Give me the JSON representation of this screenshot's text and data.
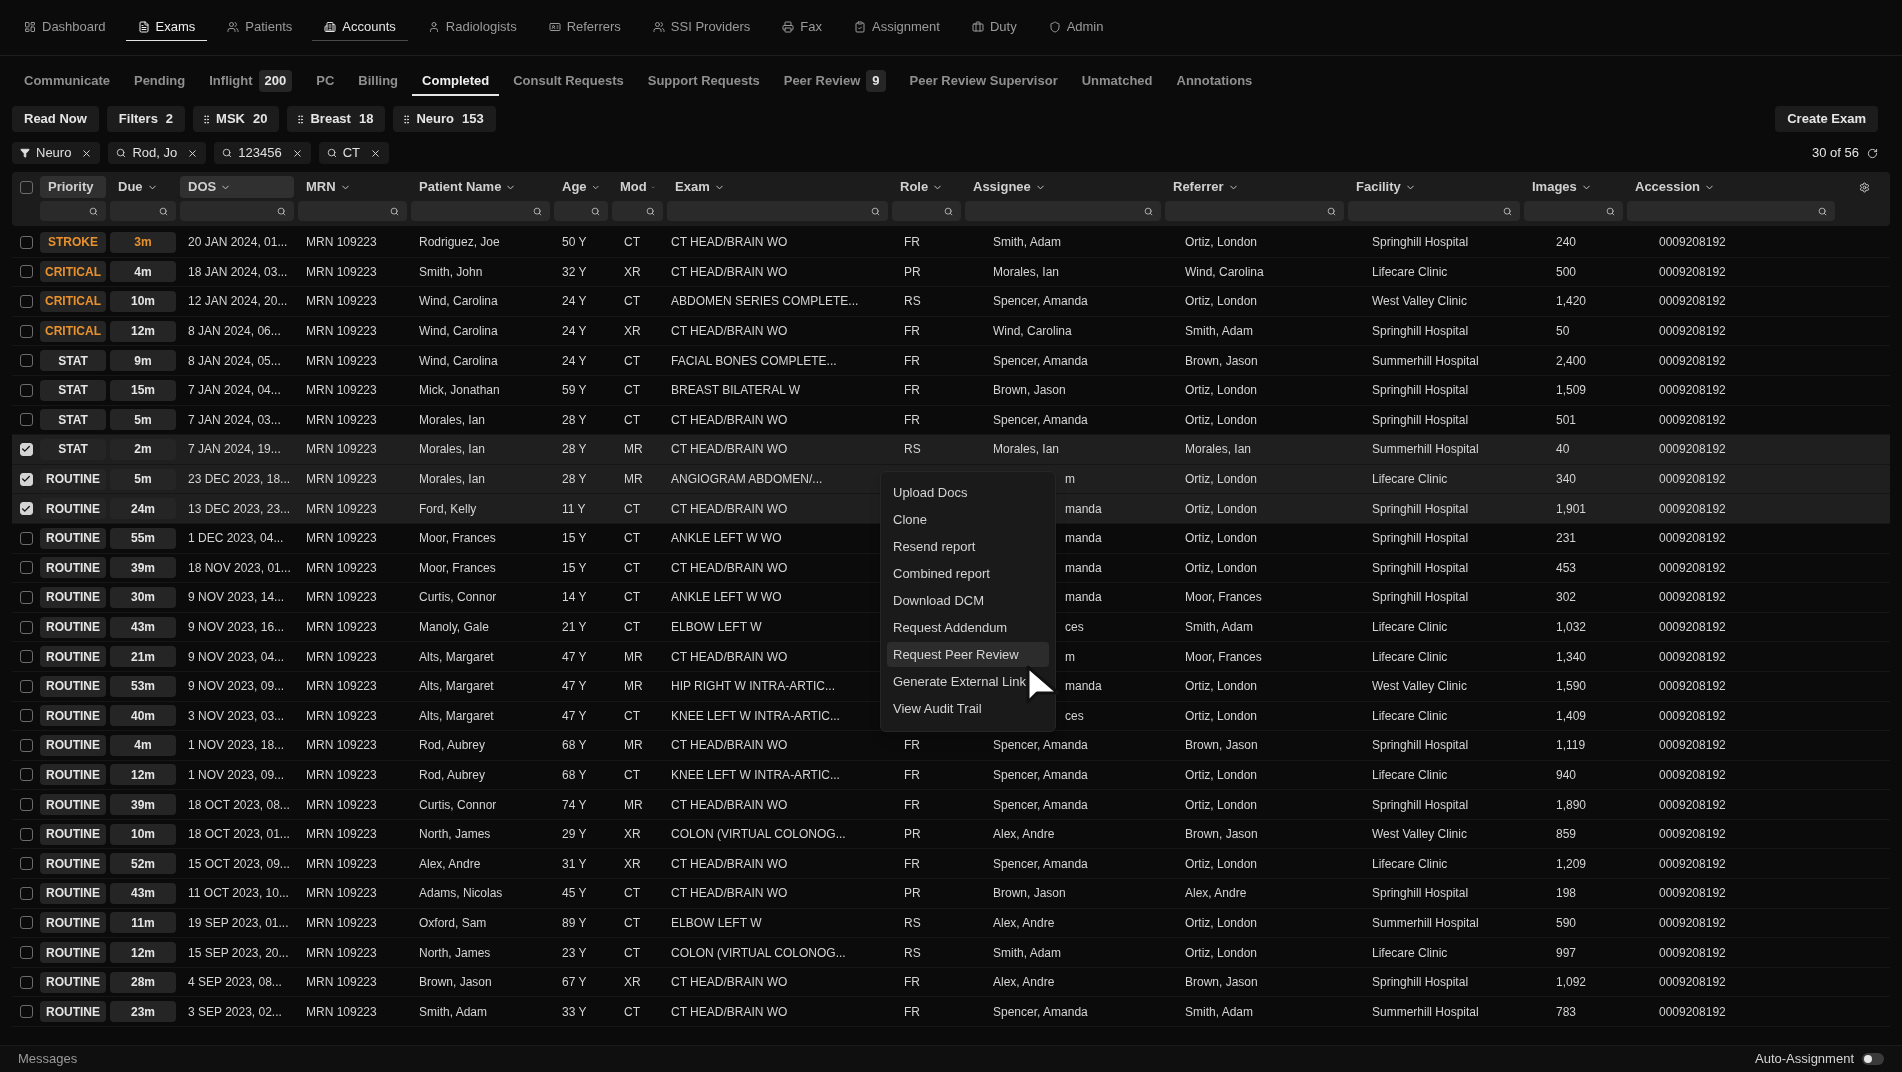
{
  "nav": [
    {
      "label": "Dashboard",
      "selected": false,
      "hovered": false
    },
    {
      "label": "Exams",
      "selected": true,
      "hovered": false
    },
    {
      "label": "Patients",
      "selected": false,
      "hovered": false
    },
    {
      "label": "Accounts",
      "selected": false,
      "hovered": true
    },
    {
      "label": "Radiologists",
      "selected": false,
      "hovered": false
    },
    {
      "label": "Referrers",
      "selected": false,
      "hovered": false
    },
    {
      "label": "SSI Providers",
      "selected": false,
      "hovered": false
    },
    {
      "label": "Fax",
      "selected": false,
      "hovered": false
    },
    {
      "label": "Assignment",
      "selected": false,
      "hovered": false
    },
    {
      "label": "Duty",
      "selected": false,
      "hovered": false
    },
    {
      "label": "Admin",
      "selected": false,
      "hovered": false
    }
  ],
  "tabs": [
    {
      "label": "Communicate",
      "selected": false
    },
    {
      "label": "Pending",
      "selected": false
    },
    {
      "label": "Inflight",
      "selected": false,
      "count": "200"
    },
    {
      "label": "PC",
      "selected": false
    },
    {
      "label": "Billing",
      "selected": false
    },
    {
      "label": "Completed",
      "selected": true
    },
    {
      "label": "Consult Requests",
      "selected": false
    },
    {
      "label": "Support Requests",
      "selected": false
    },
    {
      "label": "Peer Review",
      "selected": false,
      "count": "9"
    },
    {
      "label": "Peer Review Supervisor",
      "selected": false
    },
    {
      "label": "Unmatched",
      "selected": false
    },
    {
      "label": "Annotations",
      "selected": false
    }
  ],
  "chips": [
    {
      "kind": "button",
      "label": "Read Now"
    },
    {
      "kind": "count",
      "label": "Filters",
      "count": "2"
    },
    {
      "kind": "group",
      "label": "MSK",
      "count": "20"
    },
    {
      "kind": "group",
      "label": "Breast",
      "count": "18"
    },
    {
      "kind": "group",
      "label": "Neuro",
      "count": "153"
    }
  ],
  "create_button": "Create Exam",
  "active_filters": [
    {
      "kind": "filter",
      "label": "Neuro"
    },
    {
      "kind": "search",
      "label": "Rod, Jo"
    },
    {
      "kind": "search",
      "label": "123456"
    },
    {
      "kind": "search",
      "label": "CT"
    }
  ],
  "result_count": "30 of 56",
  "table": {
    "select_all": false,
    "columns": [
      {
        "label": "Priority",
        "sorted": true
      },
      {
        "label": "Due",
        "sorted": false
      },
      {
        "label": "DOS",
        "sorted": true
      },
      {
        "label": "MRN",
        "sorted": false
      },
      {
        "label": "Patient Name",
        "sorted": false
      },
      {
        "label": "Age",
        "sorted": false
      },
      {
        "label": "Mod",
        "sorted": false
      },
      {
        "label": "Exam",
        "sorted": false
      },
      {
        "label": "Role",
        "sorted": false
      },
      {
        "label": "Assignee",
        "sorted": false
      },
      {
        "label": "Referrer",
        "sorted": false
      },
      {
        "label": "Facility",
        "sorted": false
      },
      {
        "label": "Images",
        "sorted": false
      },
      {
        "label": "Accession",
        "sorted": false
      }
    ],
    "rows": [
      {
        "checked": false,
        "priority": {
          "kind": "stroke",
          "label": "STROKE"
        },
        "due": "3m",
        "due_urgent": true,
        "dos": "20 JAN 2024, 01...",
        "mrn": "MRN 109223",
        "patient": "Rodriguez, Joe",
        "age": "50 Y",
        "mod": "CT",
        "exam": "CT HEAD/BRAIN WO",
        "role": "FR",
        "assignee": "Smith, Adam",
        "referrer": "Ortiz, London",
        "facility": "Springhill Hospital",
        "images": "240",
        "accession": "0009208192"
      },
      {
        "checked": false,
        "priority": {
          "kind": "critical",
          "label": "CRITICAL"
        },
        "due": "4m",
        "due_urgent": false,
        "dos": "18 JAN 2024, 03...",
        "mrn": "MRN 109223",
        "patient": "Smith, John",
        "age": "32 Y",
        "mod": "XR",
        "exam": "CT HEAD/BRAIN WO",
        "role": "PR",
        "assignee": "Morales, Ian",
        "referrer": "Wind, Carolina",
        "facility": "Lifecare Clinic",
        "images": "500",
        "accession": "0009208192"
      },
      {
        "checked": false,
        "priority": {
          "kind": "critical",
          "label": "CRITICAL"
        },
        "due": "10m",
        "due_urgent": false,
        "dos": "12 JAN 2024, 20...",
        "mrn": "MRN 109223",
        "patient": "Wind, Carolina",
        "age": "24 Y",
        "mod": "CT",
        "exam": "ABDOMEN SERIES COMPLETE...",
        "role": "RS",
        "assignee": "Spencer, Amanda",
        "referrer": "Ortiz, London",
        "facility": "West Valley Clinic",
        "images": "1,420",
        "accession": "0009208192"
      },
      {
        "checked": false,
        "priority": {
          "kind": "critical",
          "label": "CRITICAL"
        },
        "due": "12m",
        "due_urgent": false,
        "dos": "8 JAN 2024, 06...",
        "mrn": "MRN 109223",
        "patient": "Wind, Carolina",
        "age": "24 Y",
        "mod": "XR",
        "exam": "CT HEAD/BRAIN WO",
        "role": "FR",
        "assignee": "Wind, Carolina",
        "referrer": "Smith, Adam",
        "facility": "Springhill Hospital",
        "images": "50",
        "accession": "0009208192"
      },
      {
        "checked": false,
        "priority": {
          "kind": "stat",
          "label": "STAT"
        },
        "due": "9m",
        "due_urgent": false,
        "dos": "8 JAN 2024, 05...",
        "mrn": "MRN 109223",
        "patient": "Wind, Carolina",
        "age": "24 Y",
        "mod": "CT",
        "exam": "FACIAL BONES COMPLETE...",
        "role": "FR",
        "assignee": "Spencer, Amanda",
        "referrer": "Brown, Jason",
        "facility": "Summerhill Hospital",
        "images": "2,400",
        "accession": "0009208192"
      },
      {
        "checked": false,
        "priority": {
          "kind": "stat",
          "label": "STAT"
        },
        "due": "15m",
        "due_urgent": false,
        "dos": "7 JAN 2024, 04...",
        "mrn": "MRN 109223",
        "patient": "Mick, Jonathan",
        "age": "59 Y",
        "mod": "CT",
        "exam": "BREAST BILATERAL W",
        "role": "FR",
        "assignee": "Brown, Jason",
        "referrer": "Ortiz, London",
        "facility": "Springhill Hospital",
        "images": "1,509",
        "accession": "0009208192"
      },
      {
        "checked": false,
        "priority": {
          "kind": "stat",
          "label": "STAT"
        },
        "due": "5m",
        "due_urgent": false,
        "dos": "7 JAN 2024, 03...",
        "mrn": "MRN 109223",
        "patient": "Morales, Ian",
        "age": "28 Y",
        "mod": "CT",
        "exam": "CT HEAD/BRAIN WO",
        "role": "FR",
        "assignee": "Spencer, Amanda",
        "referrer": "Ortiz, London",
        "facility": "Springhill Hospital",
        "images": "501",
        "accession": "0009208192"
      },
      {
        "checked": true,
        "priority": {
          "kind": "stat",
          "label": "STAT"
        },
        "due": "2m",
        "due_urgent": false,
        "dos": "7 JAN 2024, 19...",
        "mrn": "MRN 109223",
        "patient": "Morales, Ian",
        "age": "28 Y",
        "mod": "MR",
        "exam": "CT HEAD/BRAIN WO",
        "role": "RS",
        "assignee": "Morales, Ian",
        "referrer": "Morales, Ian",
        "facility": "Summerhill Hospital",
        "images": "40",
        "accession": "0009208192"
      },
      {
        "checked": true,
        "priority": {
          "kind": "routine",
          "label": "ROUTINE"
        },
        "due": "5m",
        "due_urgent": false,
        "dos": "23 DEC 2023, 18...",
        "mrn": "MRN 109223",
        "patient": "Morales, Ian",
        "age": "28 Y",
        "mod": "MR",
        "exam": "ANGIOGRAM ABDOMEN/...",
        "assignee_visible": "m",
        "referrer": "Ortiz, London",
        "facility": "Lifecare Clinic",
        "images": "340",
        "accession": "0009208192"
      },
      {
        "checked": true,
        "priority": {
          "kind": "routine",
          "label": "ROUTINE"
        },
        "due": "24m",
        "due_urgent": false,
        "dos": "13 DEC 2023, 23...",
        "mrn": "MRN 109223",
        "patient": "Ford, Kelly",
        "age": "11 Y",
        "mod": "CT",
        "exam": "CT HEAD/BRAIN WO",
        "assignee_visible": "manda",
        "referrer": "Ortiz, London",
        "facility": "Springhill Hospital",
        "images": "1,901",
        "accession": "0009208192"
      },
      {
        "checked": false,
        "priority": {
          "kind": "routine",
          "label": "ROUTINE"
        },
        "due": "55m",
        "due_urgent": false,
        "dos": "1 DEC 2023, 04...",
        "mrn": "MRN 109223",
        "patient": "Moor, Frances",
        "age": "15 Y",
        "mod": "CT",
        "exam": "ANKLE LEFT W WO",
        "assignee_visible": "manda",
        "referrer": "Ortiz, London",
        "facility": "Springhill Hospital",
        "images": "231",
        "accession": "0009208192"
      },
      {
        "checked": false,
        "priority": {
          "kind": "routine",
          "label": "ROUTINE"
        },
        "due": "39m",
        "due_urgent": false,
        "dos": "18 NOV 2023, 01...",
        "mrn": "MRN 109223",
        "patient": "Moor, Frances",
        "age": "15 Y",
        "mod": "CT",
        "exam": "CT HEAD/BRAIN WO",
        "assignee_visible": "manda",
        "referrer": "Ortiz, London",
        "facility": "Springhill Hospital",
        "images": "453",
        "accession": "0009208192"
      },
      {
        "checked": false,
        "priority": {
          "kind": "routine",
          "label": "ROUTINE"
        },
        "due": "30m",
        "due_urgent": false,
        "dos": "9 NOV 2023, 14...",
        "mrn": "MRN 109223",
        "patient": "Curtis, Connor",
        "age": "14 Y",
        "mod": "CT",
        "exam": "ANKLE LEFT W WO",
        "assignee_visible": "manda",
        "referrer": "Moor, Frances",
        "facility": "Springhill Hospital",
        "images": "302",
        "accession": "0009208192"
      },
      {
        "checked": false,
        "priority": {
          "kind": "routine",
          "label": "ROUTINE"
        },
        "due": "43m",
        "due_urgent": false,
        "dos": "9 NOV 2023, 16...",
        "mrn": "MRN 109223",
        "patient": "Manoly, Gale",
        "age": "21 Y",
        "mod": "CT",
        "exam": "ELBOW LEFT W",
        "assignee_visible": "ces",
        "referrer": "Smith, Adam",
        "facility": "Lifecare Clinic",
        "images": "1,032",
        "accession": "0009208192"
      },
      {
        "checked": false,
        "priority": {
          "kind": "routine",
          "label": "ROUTINE"
        },
        "due": "21m",
        "due_urgent": false,
        "dos": "9 NOV 2023, 04...",
        "mrn": "MRN 109223",
        "patient": "Alts, Margaret",
        "age": "47 Y",
        "mod": "MR",
        "exam": "CT HEAD/BRAIN WO",
        "assignee_visible": "m",
        "referrer": "Moor, Frances",
        "facility": "Lifecare Clinic",
        "images": "1,340",
        "accession": "0009208192"
      },
      {
        "checked": false,
        "priority": {
          "kind": "routine",
          "label": "ROUTINE"
        },
        "due": "53m",
        "due_urgent": false,
        "dos": "9 NOV 2023, 09...",
        "mrn": "MRN 109223",
        "patient": "Alts, Margaret",
        "age": "47 Y",
        "mod": "MR",
        "exam": "HIP RIGHT W INTRA-ARTIC...",
        "assignee_visible": "manda",
        "referrer": "Ortiz, London",
        "facility": "West Valley Clinic",
        "images": "1,590",
        "accession": "0009208192"
      },
      {
        "checked": false,
        "priority": {
          "kind": "routine",
          "label": "ROUTINE"
        },
        "due": "40m",
        "due_urgent": false,
        "dos": "3 NOV 2023, 03...",
        "mrn": "MRN 109223",
        "patient": "Alts, Margaret",
        "age": "47 Y",
        "mod": "CT",
        "exam": "KNEE LEFT W INTRA-ARTIC...",
        "assignee_visible": "ces",
        "referrer": "Ortiz, London",
        "facility": "Lifecare Clinic",
        "images": "1,409",
        "accession": "0009208192"
      },
      {
        "checked": false,
        "priority": {
          "kind": "routine",
          "label": "ROUTINE"
        },
        "due": "4m",
        "due_urgent": false,
        "dos": "1 NOV 2023, 18...",
        "mrn": "MRN 109223",
        "patient": "Rod, Aubrey",
        "age": "68 Y",
        "mod": "MR",
        "exam": "CT HEAD/BRAIN WO",
        "role": "FR",
        "assignee": "Spencer, Amanda",
        "referrer": "Brown, Jason",
        "facility": "Springhill Hospital",
        "images": "1,119",
        "accession": "0009208192"
      },
      {
        "checked": false,
        "priority": {
          "kind": "routine",
          "label": "ROUTINE"
        },
        "due": "12m",
        "due_urgent": false,
        "dos": "1 NOV 2023, 09...",
        "mrn": "MRN 109223",
        "patient": "Rod, Aubrey",
        "age": "68 Y",
        "mod": "CT",
        "exam": "KNEE LEFT W INTRA-ARTIC...",
        "role": "FR",
        "assignee": "Spencer, Amanda",
        "referrer": "Ortiz, London",
        "facility": "Lifecare Clinic",
        "images": "940",
        "accession": "0009208192"
      },
      {
        "checked": false,
        "priority": {
          "kind": "routine",
          "label": "ROUTINE"
        },
        "due": "39m",
        "due_urgent": false,
        "dos": "18 OCT 2023, 08...",
        "mrn": "MRN 109223",
        "patient": "Curtis, Connor",
        "age": "74 Y",
        "mod": "MR",
        "exam": "CT HEAD/BRAIN WO",
        "role": "FR",
        "assignee": "Spencer, Amanda",
        "referrer": "Ortiz, London",
        "facility": "Springhill Hospital",
        "images": "1,890",
        "accession": "0009208192"
      },
      {
        "checked": false,
        "priority": {
          "kind": "routine",
          "label": "ROUTINE"
        },
        "due": "10m",
        "due_urgent": false,
        "dos": "18 OCT 2023, 01...",
        "mrn": "MRN 109223",
        "patient": "North, James",
        "age": "29 Y",
        "mod": "XR",
        "exam": "COLON (VIRTUAL COLONOG...",
        "role": "PR",
        "assignee": "Alex, Andre",
        "referrer": "Brown, Jason",
        "facility": "West Valley Clinic",
        "images": "859",
        "accession": "0009208192"
      },
      {
        "checked": false,
        "priority": {
          "kind": "routine",
          "label": "ROUTINE"
        },
        "due": "52m",
        "due_urgent": false,
        "dos": "15 OCT 2023, 09...",
        "mrn": "MRN 109223",
        "patient": "Alex, Andre",
        "age": "31 Y",
        "mod": "XR",
        "exam": "CT HEAD/BRAIN WO",
        "role": "FR",
        "assignee": "Spencer, Amanda",
        "referrer": "Ortiz, London",
        "facility": "Lifecare Clinic",
        "images": "1,209",
        "accession": "0009208192"
      },
      {
        "checked": false,
        "priority": {
          "kind": "routine",
          "label": "ROUTINE"
        },
        "due": "43m",
        "due_urgent": false,
        "dos": "11 OCT 2023, 10...",
        "mrn": "MRN 109223",
        "patient": "Adams, Nicolas",
        "age": "45 Y",
        "mod": "CT",
        "exam": "CT HEAD/BRAIN WO",
        "role": "PR",
        "assignee": "Brown, Jason",
        "referrer": "Alex, Andre",
        "facility": "Springhill Hospital",
        "images": "198",
        "accession": "0009208192"
      },
      {
        "checked": false,
        "priority": {
          "kind": "routine",
          "label": "ROUTINE"
        },
        "due": "11m",
        "due_urgent": false,
        "dos": "19 SEP 2023, 01...",
        "mrn": "MRN 109223",
        "patient": "Oxford, Sam",
        "age": "89 Y",
        "mod": "CT",
        "exam": "ELBOW LEFT W",
        "role": "RS",
        "assignee": "Alex, Andre",
        "referrer": "Ortiz, London",
        "facility": "Summerhill Hospital",
        "images": "590",
        "accession": "0009208192"
      },
      {
        "checked": false,
        "priority": {
          "kind": "routine",
          "label": "ROUTINE"
        },
        "due": "12m",
        "due_urgent": false,
        "dos": "15 SEP 2023, 20...",
        "mrn": "MRN 109223",
        "patient": "North, James",
        "age": "23 Y",
        "mod": "CT",
        "exam": "COLON (VIRTUAL COLONOG...",
        "role": "RS",
        "assignee": "Smith, Adam",
        "referrer": "Ortiz, London",
        "facility": "Lifecare Clinic",
        "images": "997",
        "accession": "0009208192"
      },
      {
        "checked": false,
        "priority": {
          "kind": "routine",
          "label": "ROUTINE"
        },
        "due": "28m",
        "due_urgent": false,
        "dos": "4 SEP 2023, 08...",
        "mrn": "MRN 109223",
        "patient": "Brown, Jason",
        "age": "67 Y",
        "mod": "XR",
        "exam": "CT HEAD/BRAIN WO",
        "role": "FR",
        "assignee": "Alex, Andre",
        "referrer": "Brown, Jason",
        "facility": "Springhill Hospital",
        "images": "1,092",
        "accession": "0009208192"
      },
      {
        "checked": false,
        "priority": {
          "kind": "routine",
          "label": "ROUTINE"
        },
        "due": "23m",
        "due_urgent": false,
        "dos": "3 SEP 2023, 02...",
        "mrn": "MRN 109223",
        "patient": "Smith, Adam",
        "age": "33 Y",
        "mod": "CT",
        "exam": "CT HEAD/BRAIN WO",
        "role": "FR",
        "assignee": "Spencer, Amanda",
        "referrer": "Smith, Adam",
        "facility": "Summerhill Hospital",
        "images": "783",
        "accession": "0009208192"
      }
    ]
  },
  "context_menu": [
    {
      "label": "Upload Docs",
      "selected": false
    },
    {
      "label": "Clone",
      "selected": false
    },
    {
      "label": "Resend report",
      "selected": false
    },
    {
      "label": "Combined report",
      "selected": false
    },
    {
      "label": "Download DCM",
      "selected": false
    },
    {
      "label": "Request Addendum",
      "selected": false
    },
    {
      "label": "Request Peer Review",
      "selected": true
    },
    {
      "label": "Generate External Link",
      "selected": false
    },
    {
      "label": "View Audit Trail",
      "selected": false
    }
  ],
  "footer": {
    "messages": "Messages",
    "auto_assignment": {
      "label": "Auto-Assignment",
      "on": false
    }
  }
}
